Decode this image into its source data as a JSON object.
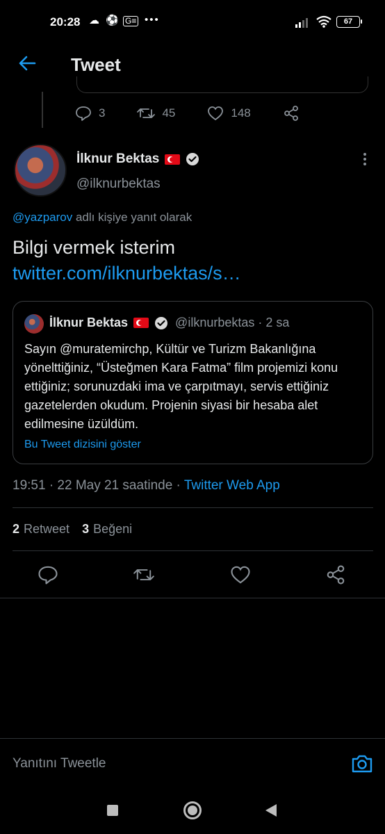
{
  "status_bar": {
    "time": "20:28",
    "battery": "67"
  },
  "header": {
    "title": "Tweet"
  },
  "previous_tweet": {
    "replies": "3",
    "retweets": "45",
    "likes": "148"
  },
  "tweet": {
    "author_name": "İlknur Bektas",
    "author_handle": "@ilknurbektas",
    "reply_mention": "@yazparov",
    "reply_suffix": " adlı kişiye yanıt olarak",
    "text": "Bilgi vermek isterim",
    "link": "twitter.com/ilknurbektas/s…",
    "timestamp": "19:51 · 22 May 21 saatinde · ",
    "source_app": "Twitter Web App",
    "retweet_count": "2",
    "retweet_label": "Retweet",
    "like_count": "3",
    "like_label": "Beğeni"
  },
  "quoted_tweet": {
    "author_name": "İlknur Bektas",
    "author_handle": "@ilknurbektas · 2 sa",
    "text": "Sayın @muratemirchp,  Kültür ve Turizm Bakanlığına yönelttiğiniz, “Üsteğmen Kara Fatma” film projemizi konu ettiğiniz; sorunuzdaki ima ve çarpıtmayı, servis ettiğiniz gazetelerden okudum. Projenin siyasi bir hesaba alet edilmesine üzüldüm.",
    "thread_link": "Bu Tweet dizisini göster"
  },
  "compose": {
    "placeholder": "Yanıtını Tweetle"
  },
  "colors": {
    "accent": "#1d9bf0",
    "background": "#000000",
    "muted": "#8b9299",
    "flag": "#e30a17"
  }
}
